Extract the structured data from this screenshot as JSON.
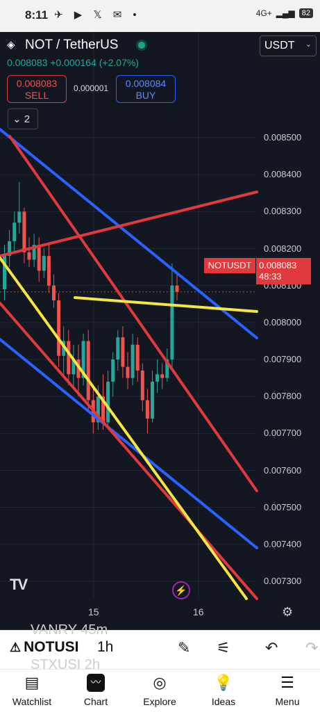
{
  "status": {
    "time": "8:11",
    "notifications": "✈ ▶ 𝕏 ✉ •",
    "network": "4G+",
    "battery": "82"
  },
  "header": {
    "symbol": "NOT / TetherUS",
    "currency": "USDT",
    "last": "0.008083",
    "change": "+0.000164",
    "change_pct": "(+2.07%)",
    "sell_price": "0.008083",
    "sell_label": "SELL",
    "spread": "0.000001",
    "buy_price": "0.008084",
    "buy_label": "BUY",
    "indicators_count": "2"
  },
  "price_axis": [
    "0.008500",
    "0.008400",
    "0.008300",
    "0.008200",
    "0.008100",
    "0.008000",
    "0.007900",
    "0.007800",
    "0.007700",
    "0.007600",
    "0.007500",
    "0.007400",
    "0.007300"
  ],
  "last_tag": {
    "symbol": "NOTUSDT",
    "price": "0.008083",
    "countdown": "48:33"
  },
  "date_axis": [
    "15",
    "16"
  ],
  "toolbar": {
    "ticker": "NOTUSI",
    "interval": "1h",
    "ghost_top": "VANRY  45m",
    "ghost_bottom": "STXUSI  2h"
  },
  "nav": [
    {
      "label": "Watchlist",
      "icon": "watchlist-icon"
    },
    {
      "label": "Chart",
      "icon": "chart-icon"
    },
    {
      "label": "Explore",
      "icon": "compass-icon"
    },
    {
      "label": "Ideas",
      "icon": "ideas-icon"
    },
    {
      "label": "Menu",
      "icon": "menu-icon"
    }
  ],
  "chart_data": {
    "type": "candlestick",
    "symbol": "NOTUSDT",
    "timeframe": "1h",
    "ylim": [
      0.00725,
      0.00858
    ],
    "candles": [
      [
        0.00809,
        0.00821,
        0.00806,
        0.00818
      ],
      [
        0.00818,
        0.00825,
        0.00815,
        0.00822
      ],
      [
        0.00822,
        0.0083,
        0.00819,
        0.00827
      ],
      [
        0.00827,
        0.00838,
        0.00824,
        0.0083
      ],
      [
        0.0083,
        0.00831,
        0.00816,
        0.00819
      ],
      [
        0.00819,
        0.00823,
        0.00815,
        0.00817
      ],
      [
        0.00817,
        0.00824,
        0.00815,
        0.00821
      ],
      [
        0.00821,
        0.00823,
        0.00811,
        0.00814
      ],
      [
        0.00814,
        0.0082,
        0.00812,
        0.00818
      ],
      [
        0.00818,
        0.00821,
        0.00808,
        0.0081
      ],
      [
        0.0081,
        0.00813,
        0.00804,
        0.00806
      ],
      [
        0.00806,
        0.00808,
        0.00788,
        0.00791
      ],
      [
        0.00791,
        0.00799,
        0.00785,
        0.00795
      ],
      [
        0.00795,
        0.00798,
        0.00783,
        0.00786
      ],
      [
        0.00786,
        0.00794,
        0.00782,
        0.0079
      ],
      [
        0.0079,
        0.00794,
        0.0078,
        0.00785
      ],
      [
        0.00785,
        0.00797,
        0.00783,
        0.00795
      ],
      [
        0.00795,
        0.00798,
        0.00776,
        0.00779
      ],
      [
        0.00779,
        0.00783,
        0.0077,
        0.00773
      ],
      [
        0.00773,
        0.00783,
        0.00771,
        0.0078
      ],
      [
        0.0078,
        0.00786,
        0.00771,
        0.00773
      ],
      [
        0.00773,
        0.00787,
        0.00771,
        0.00784
      ],
      [
        0.00784,
        0.00792,
        0.0078,
        0.0079
      ],
      [
        0.0079,
        0.00798,
        0.00787,
        0.00796
      ],
      [
        0.00796,
        0.00799,
        0.00785,
        0.00788
      ],
      [
        0.00788,
        0.00792,
        0.00782,
        0.00785
      ],
      [
        0.00785,
        0.00797,
        0.00783,
        0.00794
      ],
      [
        0.00794,
        0.00796,
        0.00784,
        0.00787
      ],
      [
        0.00787,
        0.00789,
        0.00776,
        0.00779
      ],
      [
        0.00779,
        0.00782,
        0.0077,
        0.00774
      ],
      [
        0.00774,
        0.00787,
        0.00773,
        0.00784
      ],
      [
        0.00784,
        0.0079,
        0.00781,
        0.00786
      ],
      [
        0.00786,
        0.00789,
        0.00782,
        0.00785
      ],
      [
        0.00785,
        0.00793,
        0.00784,
        0.0079
      ],
      [
        0.0079,
        0.00816,
        0.00788,
        0.0081
      ],
      [
        0.0081,
        0.00813,
        0.00806,
        0.008083
      ]
    ]
  }
}
